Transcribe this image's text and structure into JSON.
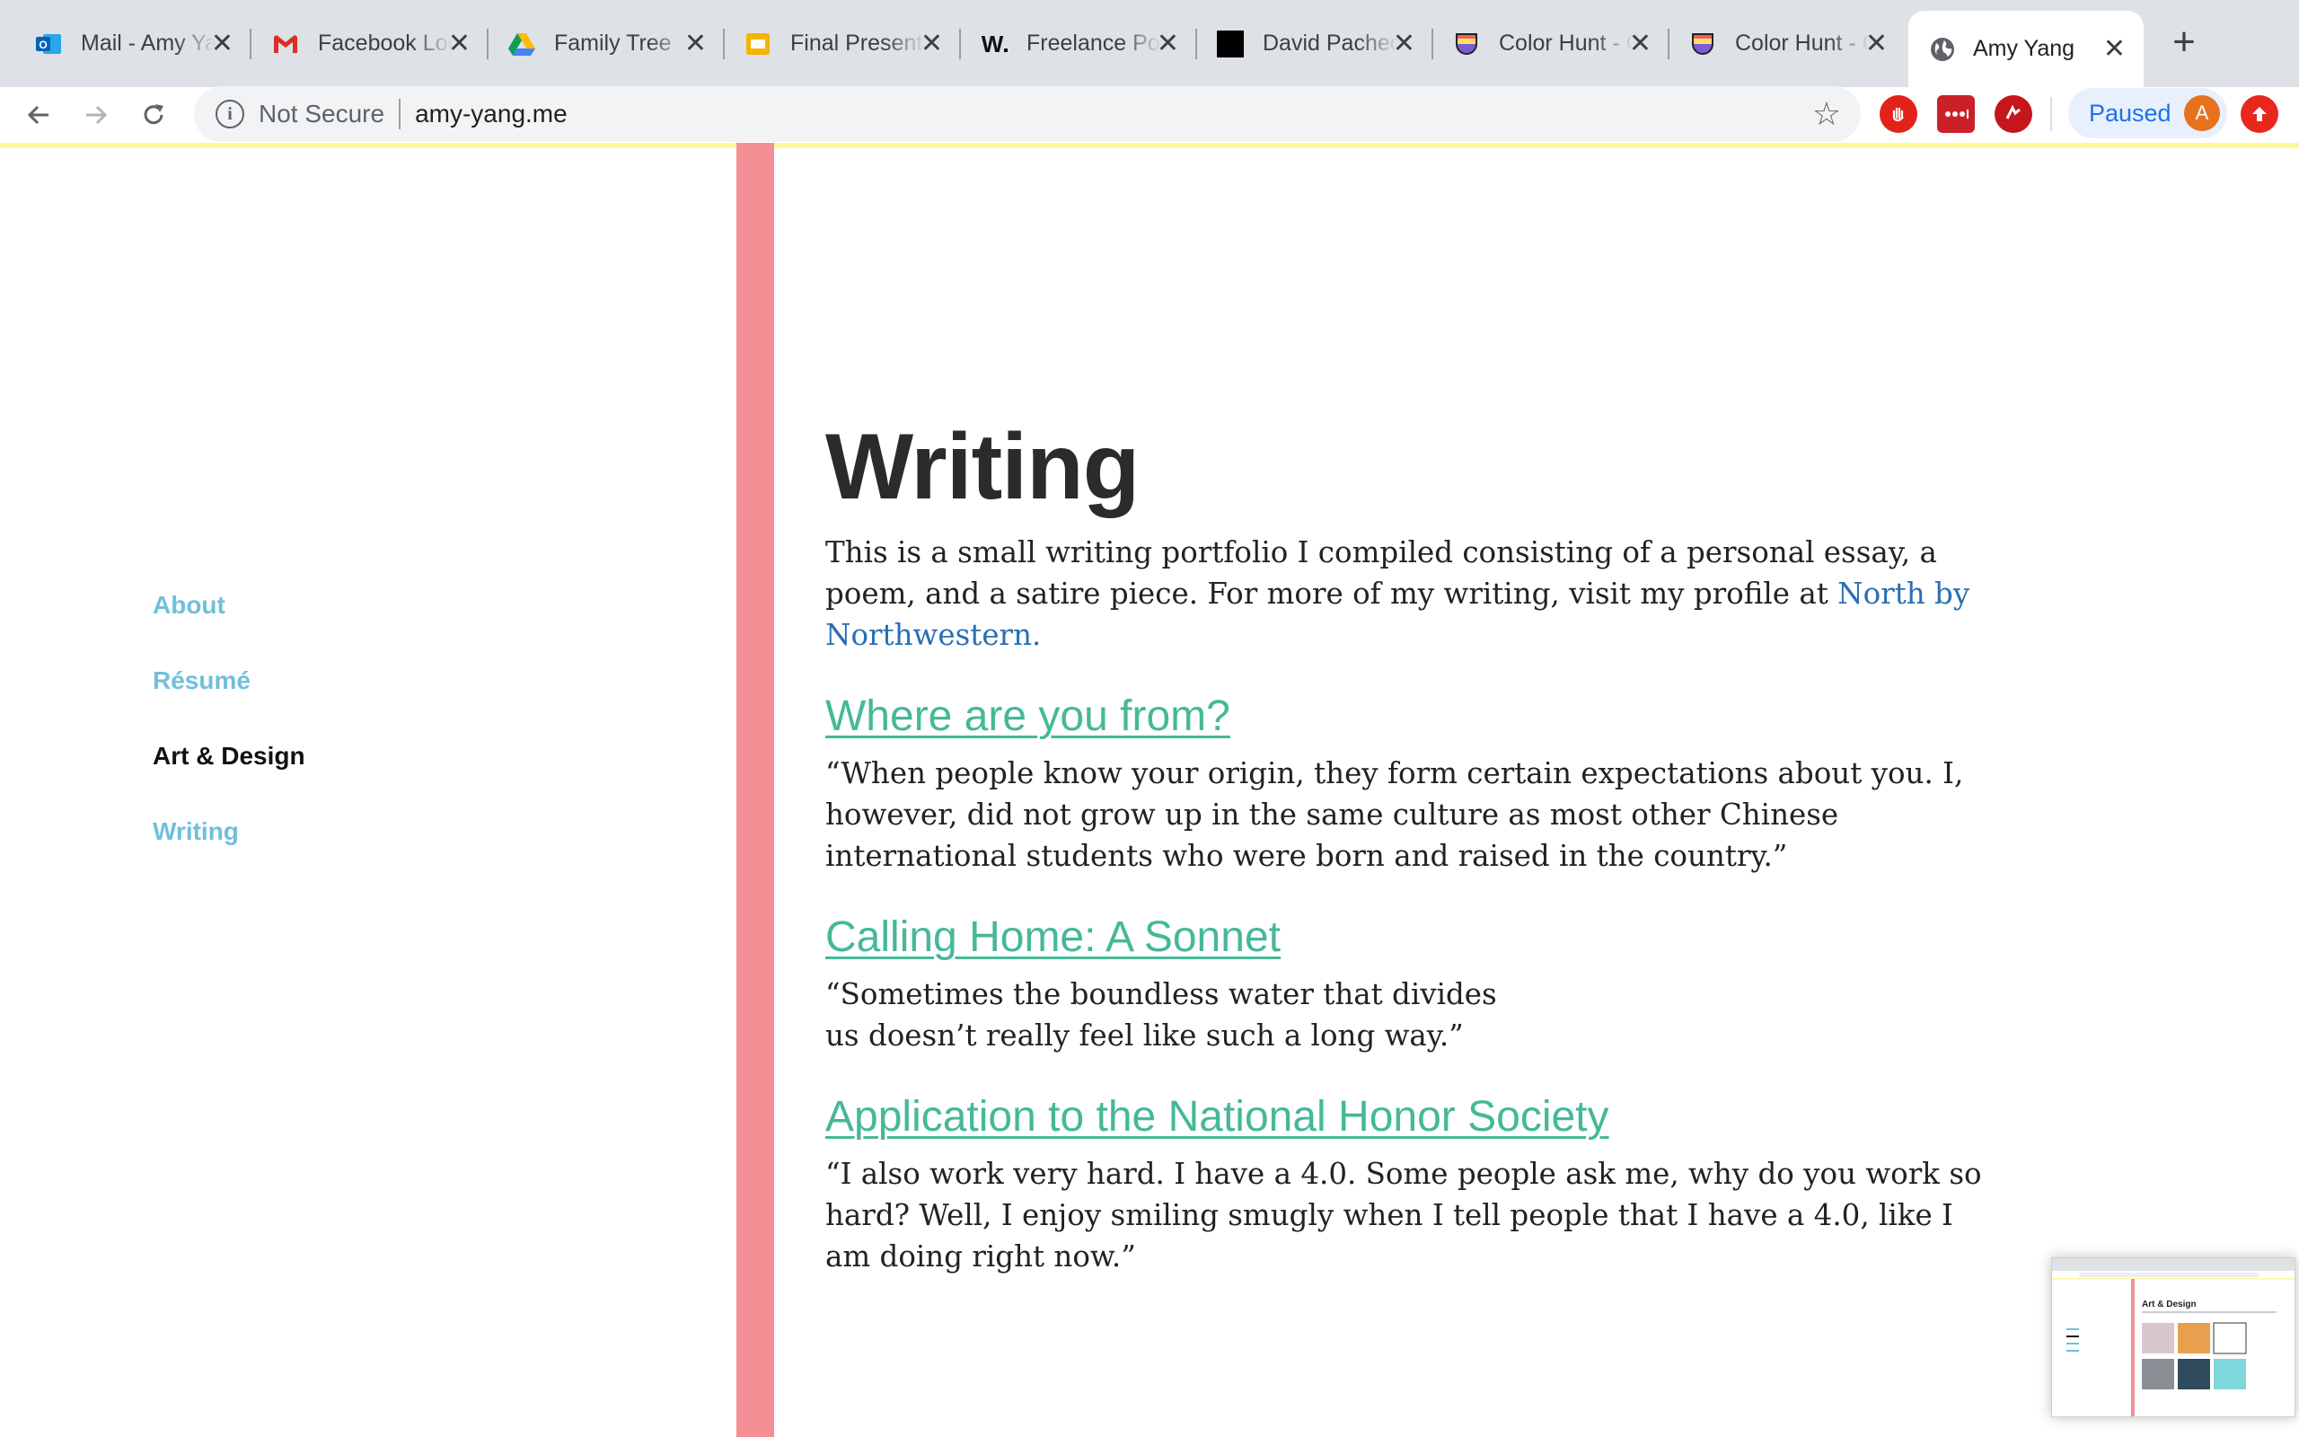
{
  "browser": {
    "tabs": [
      {
        "title": "Mail - Amy Yang",
        "favicon": "outlook-icon",
        "active": false
      },
      {
        "title": "Facebook Login",
        "favicon": "gmail-icon",
        "active": false
      },
      {
        "title": "Family Tree",
        "favicon": "google-drive-icon",
        "active": false
      },
      {
        "title": "Final Presentation",
        "favicon": "google-slides-icon",
        "active": false
      },
      {
        "title": "Freelance Portfolio",
        "favicon": "w-logo-icon",
        "active": false
      },
      {
        "title": "David Pacheco",
        "favicon": "black-square-icon",
        "active": false
      },
      {
        "title": "Color Hunt - Color",
        "favicon": "color-hunt-icon",
        "active": false
      },
      {
        "title": "Color Hunt - Color",
        "favicon": "color-hunt-icon",
        "active": false
      },
      {
        "title": "Amy Yang",
        "favicon": "globe-icon",
        "active": true
      }
    ],
    "new_tab_symbol": "+",
    "close_symbol": "✕",
    "security_label": "Not Secure",
    "url": "amy-yang.me",
    "profile_status": "Paused",
    "profile_initial": "A",
    "extensions": [
      "adblock-icon",
      "lastpass-icon",
      "extension-red-icon",
      "update-icon"
    ]
  },
  "sidebar": {
    "items": [
      {
        "label": "About",
        "state": "link"
      },
      {
        "label": "Résumé",
        "state": "link"
      },
      {
        "label": "Art & Design",
        "state": "current"
      },
      {
        "label": "Writing",
        "state": "link"
      }
    ]
  },
  "main": {
    "title": "Writing",
    "intro_text": "This is a small writing portfolio I compiled consisting of a personal essay, a poem, and a satire piece. For more of my writing, visit my profile at",
    "intro_link": "North by Northwestern.",
    "pieces": [
      {
        "title": "Where are you from?",
        "excerpt": "“When people know your origin, they form certain expectations about you. I, however, did not grow up in the same culture as most other Chinese international students who were born and raised in the country.”"
      },
      {
        "title": "Calling Home: A Sonnet",
        "excerpt_line1": "“Sometimes the boundless water that divides",
        "excerpt_line2": "us doesn’t really feel like such a long way.”"
      },
      {
        "title": "Application to the National Honor Society",
        "excerpt": "“I also work very hard. I have a 4.0. Some people ask me, why do you work so hard? Well, I enjoy smiling smugly when I tell people that I have a 4.0, like I am doing right now.”"
      }
    ]
  },
  "thumbnail": {
    "heading": "Art & Design"
  },
  "colors": {
    "accent_stripe": "#f48f96",
    "nav_link": "#6fbfdc",
    "piece_link": "#45b898",
    "intro_link": "#2a6eb4",
    "top_bar": "#fff79e"
  }
}
